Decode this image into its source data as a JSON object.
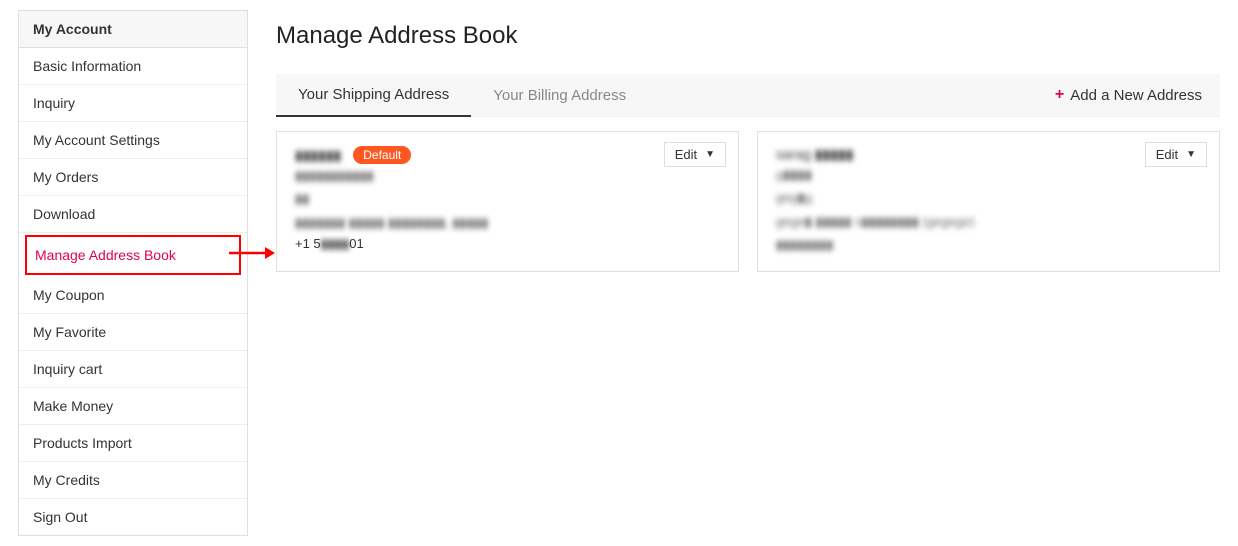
{
  "sidebar": {
    "header": "My Account",
    "items": [
      "Basic Information",
      "Inquiry",
      "My Account Settings",
      "My Orders",
      "Download",
      "Manage Address Book",
      "My Coupon",
      "My Favorite",
      "Inquiry cart",
      "Make Money",
      "Products Import",
      "My Credits",
      "Sign Out"
    ],
    "activeIndex": 5
  },
  "main": {
    "title": "Manage Address Book",
    "tabs": {
      "shipping": "Your Shipping Address",
      "billing": "Your Billing Address"
    },
    "addLabel": "Add a New Address",
    "cards": [
      {
        "name": "▮▮▮▮▮▮",
        "defaultBadge": "Default",
        "line1": "▮▮▮▮▮▮▮▮▮▮▮",
        "line2": "▮▮",
        "line3": "▮▮▮▮▮▮▮ ▮▮▮▮▮ ▮▮▮▮▮▮▮▮, ▮▮▮▮▮",
        "phonePrefix": "+1 5",
        "phoneMid": "▮▮▮▮",
        "phoneSuffix": "01",
        "editLabel": "Edit"
      },
      {
        "name": "sarag ▮▮▮▮▮",
        "line1": "g▮▮▮▮",
        "line2": "geg▮g",
        "line3": "gege▮ ▮▮▮▮▮ s▮▮▮▮▮▮▮▮ (gegege)",
        "line4": "▮▮▮▮▮▮▮▮",
        "editLabel": "Edit"
      }
    ]
  }
}
